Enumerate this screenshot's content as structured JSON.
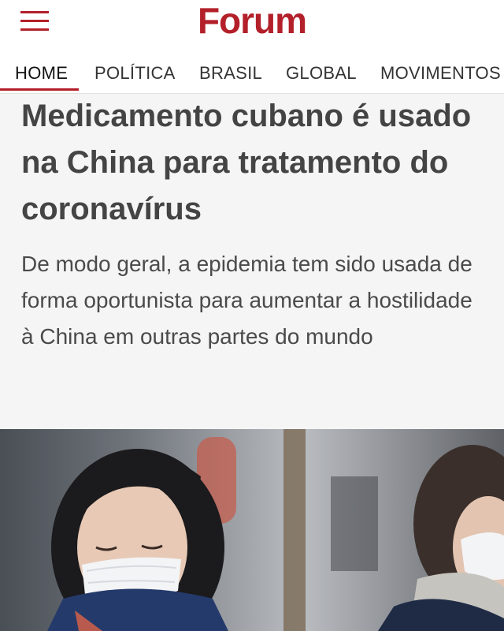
{
  "header": {
    "logo_text": "Forum",
    "brand_color": "#b3202a",
    "menu_icon": "hamburger-menu-icon"
  },
  "nav": {
    "items": [
      "HOME",
      "POLÍTICA",
      "BRASIL",
      "GLOBAL",
      "MOVIMENTOS"
    ],
    "active": "HOME"
  },
  "article": {
    "headline": "Medicamento cubano é usado na China para tratamento do coronavírus",
    "subtitle": "De modo geral, a epidemia tem sido usada de forma oportunista para aumentar a hostilidade à China em outras partes do mundo",
    "image": "photo-two-people-wearing-face-masks"
  }
}
